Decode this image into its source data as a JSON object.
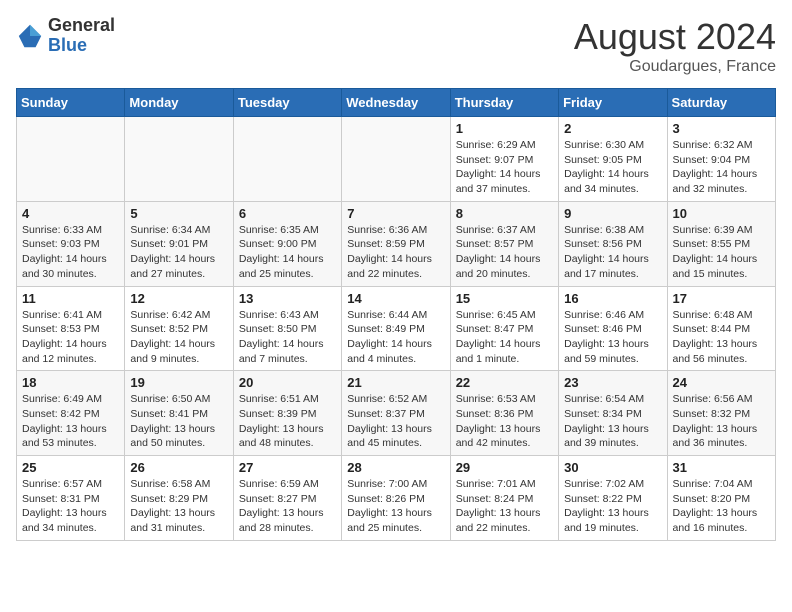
{
  "logo": {
    "general": "General",
    "blue": "Blue"
  },
  "header": {
    "month_year": "August 2024",
    "location": "Goudargues, France"
  },
  "weekdays": [
    "Sunday",
    "Monday",
    "Tuesday",
    "Wednesday",
    "Thursday",
    "Friday",
    "Saturday"
  ],
  "weeks": [
    [
      {
        "day": "",
        "info": ""
      },
      {
        "day": "",
        "info": ""
      },
      {
        "day": "",
        "info": ""
      },
      {
        "day": "",
        "info": ""
      },
      {
        "day": "1",
        "info": "Sunrise: 6:29 AM\nSunset: 9:07 PM\nDaylight: 14 hours and 37 minutes."
      },
      {
        "day": "2",
        "info": "Sunrise: 6:30 AM\nSunset: 9:05 PM\nDaylight: 14 hours and 34 minutes."
      },
      {
        "day": "3",
        "info": "Sunrise: 6:32 AM\nSunset: 9:04 PM\nDaylight: 14 hours and 32 minutes."
      }
    ],
    [
      {
        "day": "4",
        "info": "Sunrise: 6:33 AM\nSunset: 9:03 PM\nDaylight: 14 hours and 30 minutes."
      },
      {
        "day": "5",
        "info": "Sunrise: 6:34 AM\nSunset: 9:01 PM\nDaylight: 14 hours and 27 minutes."
      },
      {
        "day": "6",
        "info": "Sunrise: 6:35 AM\nSunset: 9:00 PM\nDaylight: 14 hours and 25 minutes."
      },
      {
        "day": "7",
        "info": "Sunrise: 6:36 AM\nSunset: 8:59 PM\nDaylight: 14 hours and 22 minutes."
      },
      {
        "day": "8",
        "info": "Sunrise: 6:37 AM\nSunset: 8:57 PM\nDaylight: 14 hours and 20 minutes."
      },
      {
        "day": "9",
        "info": "Sunrise: 6:38 AM\nSunset: 8:56 PM\nDaylight: 14 hours and 17 minutes."
      },
      {
        "day": "10",
        "info": "Sunrise: 6:39 AM\nSunset: 8:55 PM\nDaylight: 14 hours and 15 minutes."
      }
    ],
    [
      {
        "day": "11",
        "info": "Sunrise: 6:41 AM\nSunset: 8:53 PM\nDaylight: 14 hours and 12 minutes."
      },
      {
        "day": "12",
        "info": "Sunrise: 6:42 AM\nSunset: 8:52 PM\nDaylight: 14 hours and 9 minutes."
      },
      {
        "day": "13",
        "info": "Sunrise: 6:43 AM\nSunset: 8:50 PM\nDaylight: 14 hours and 7 minutes."
      },
      {
        "day": "14",
        "info": "Sunrise: 6:44 AM\nSunset: 8:49 PM\nDaylight: 14 hours and 4 minutes."
      },
      {
        "day": "15",
        "info": "Sunrise: 6:45 AM\nSunset: 8:47 PM\nDaylight: 14 hours and 1 minute."
      },
      {
        "day": "16",
        "info": "Sunrise: 6:46 AM\nSunset: 8:46 PM\nDaylight: 13 hours and 59 minutes."
      },
      {
        "day": "17",
        "info": "Sunrise: 6:48 AM\nSunset: 8:44 PM\nDaylight: 13 hours and 56 minutes."
      }
    ],
    [
      {
        "day": "18",
        "info": "Sunrise: 6:49 AM\nSunset: 8:42 PM\nDaylight: 13 hours and 53 minutes."
      },
      {
        "day": "19",
        "info": "Sunrise: 6:50 AM\nSunset: 8:41 PM\nDaylight: 13 hours and 50 minutes."
      },
      {
        "day": "20",
        "info": "Sunrise: 6:51 AM\nSunset: 8:39 PM\nDaylight: 13 hours and 48 minutes."
      },
      {
        "day": "21",
        "info": "Sunrise: 6:52 AM\nSunset: 8:37 PM\nDaylight: 13 hours and 45 minutes."
      },
      {
        "day": "22",
        "info": "Sunrise: 6:53 AM\nSunset: 8:36 PM\nDaylight: 13 hours and 42 minutes."
      },
      {
        "day": "23",
        "info": "Sunrise: 6:54 AM\nSunset: 8:34 PM\nDaylight: 13 hours and 39 minutes."
      },
      {
        "day": "24",
        "info": "Sunrise: 6:56 AM\nSunset: 8:32 PM\nDaylight: 13 hours and 36 minutes."
      }
    ],
    [
      {
        "day": "25",
        "info": "Sunrise: 6:57 AM\nSunset: 8:31 PM\nDaylight: 13 hours and 34 minutes."
      },
      {
        "day": "26",
        "info": "Sunrise: 6:58 AM\nSunset: 8:29 PM\nDaylight: 13 hours and 31 minutes."
      },
      {
        "day": "27",
        "info": "Sunrise: 6:59 AM\nSunset: 8:27 PM\nDaylight: 13 hours and 28 minutes."
      },
      {
        "day": "28",
        "info": "Sunrise: 7:00 AM\nSunset: 8:26 PM\nDaylight: 13 hours and 25 minutes."
      },
      {
        "day": "29",
        "info": "Sunrise: 7:01 AM\nSunset: 8:24 PM\nDaylight: 13 hours and 22 minutes."
      },
      {
        "day": "30",
        "info": "Sunrise: 7:02 AM\nSunset: 8:22 PM\nDaylight: 13 hours and 19 minutes."
      },
      {
        "day": "31",
        "info": "Sunrise: 7:04 AM\nSunset: 8:20 PM\nDaylight: 13 hours and 16 minutes."
      }
    ]
  ]
}
